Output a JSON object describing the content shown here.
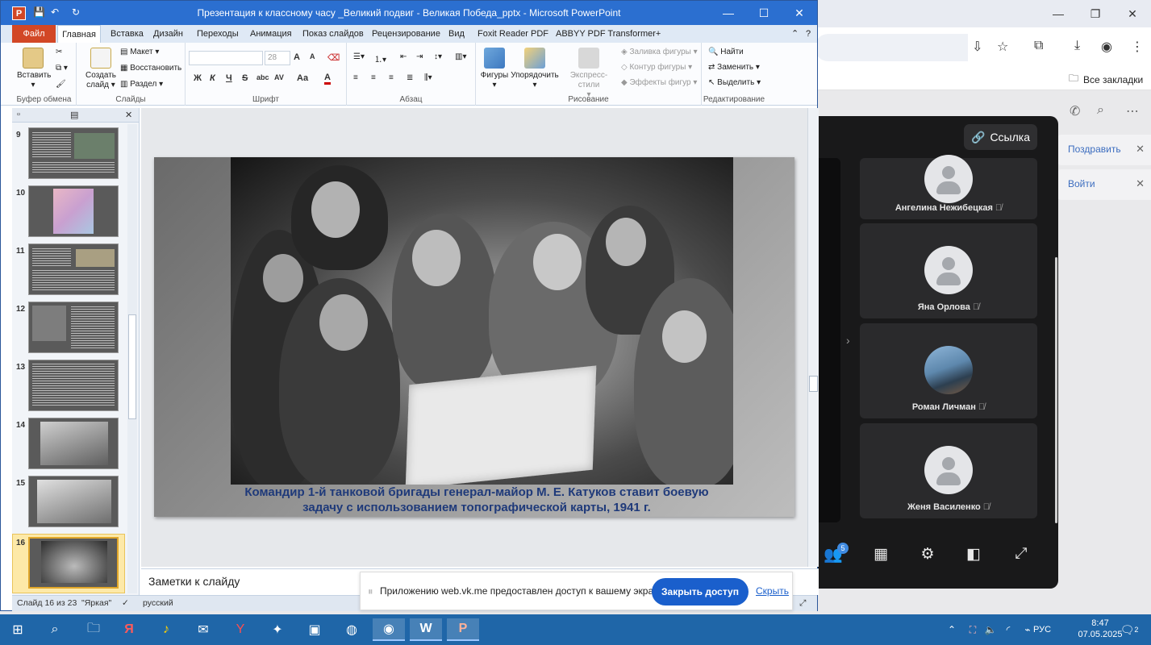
{
  "browser": {
    "bookmarks_all": "Все закладки",
    "vk_side": {
      "congratulate": "Поздравить",
      "login": "Войти"
    }
  },
  "call": {
    "link_button": "Ссылка",
    "participants": [
      {
        "name": "Ангелина Нежибецкая"
      },
      {
        "name": "Яна Орлова"
      },
      {
        "name": "Роман Личман"
      },
      {
        "name": "Женя Василенко"
      }
    ],
    "participants_count": "5"
  },
  "ppt": {
    "window_title": "Презентация к классному часу _Великий подвиг - Великая Победа_pptx - Microsoft PowerPoint",
    "tabs": [
      "Файл",
      "Главная",
      "Вставка",
      "Дизайн",
      "Переходы",
      "Анимация",
      "Показ слайдов",
      "Рецензирование",
      "Вид",
      "Foxit Reader PDF",
      "ABBYY PDF Transformer+"
    ],
    "ribbon": {
      "clipboard": {
        "paste": "Вставить",
        "label": "Буфер обмена"
      },
      "slides": {
        "create": "Создать",
        "create2": "слайд",
        "layout": "Макет",
        "reset": "Восстановить",
        "section": "Раздел",
        "label": "Слайды"
      },
      "font": {
        "size": "28",
        "label": "Шрифт",
        "bold": "Ж",
        "italic": "К",
        "underline": "Ч",
        "strike": "S",
        "shadow": "abc",
        "spacing": "AV",
        "case": "Aa",
        "color": "A",
        "grow": "A",
        "shrink": "A"
      },
      "paragraph": {
        "label": "Абзац"
      },
      "drawing": {
        "shapes": "Фигуры",
        "arrange": "Упорядочить",
        "quick_styles": "Экспресс-стили",
        "fill": "Заливка фигуры",
        "outline": "Контур фигуры",
        "effects": "Эффекты фигур",
        "label": "Рисование"
      },
      "editing": {
        "find": "Найти",
        "replace": "Заменить",
        "select": "Выделить",
        "label": "Редактирование"
      }
    },
    "thumbnails": [
      "9",
      "10",
      "11",
      "12",
      "13",
      "14",
      "15",
      "16"
    ],
    "slide": {
      "caption_line1": "Командир 1-й танковой  бригады  генерал-майор М. Е. Катуков ставит боевую",
      "caption_line2": "задачу с использованием топографической карты, 1941 г."
    },
    "notes_placeholder": "Заметки к слайду",
    "status": {
      "slide": "Слайд 16 из 23",
      "theme": "\"Яркая\"",
      "language": "русский"
    }
  },
  "share_banner": {
    "message": "Приложению web.vk.me предоставлен доступ к вашему экрану.",
    "stop_button": "Закрыть доступ",
    "hide": "Скрыть"
  },
  "taskbar": {
    "language": "РУС",
    "time": "8:47",
    "date": "07.05.2025",
    "notifications": "2"
  }
}
